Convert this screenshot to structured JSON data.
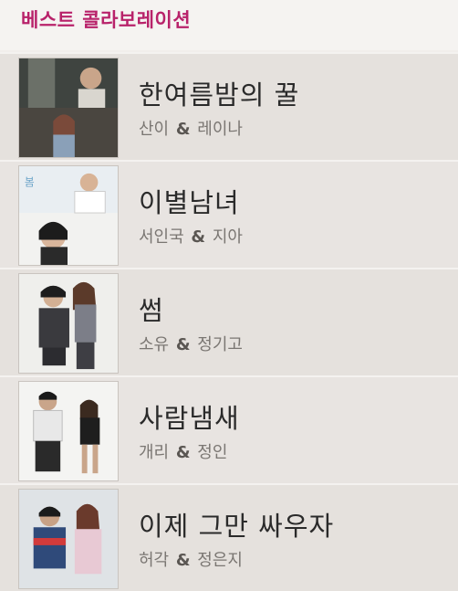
{
  "header": {
    "title": "베스트 콜라보레이션"
  },
  "colors": {
    "title": "#b8226a",
    "song": "#2a2a2a",
    "artist": "#7a7672",
    "row_bg": "#e5e1dd",
    "page_bg": "#f1eeeb"
  },
  "collaborations": [
    {
      "song": "한여름밤의 꿀",
      "artist_a": "산이",
      "separator": "&",
      "artist_b": "레이나",
      "thumbnail_icon": "album-art-photo"
    },
    {
      "song": "이별남녀",
      "artist_a": "서인국",
      "separator": "&",
      "artist_b": "지아",
      "thumbnail_icon": "album-art-photo"
    },
    {
      "song": "썸",
      "artist_a": "소유",
      "separator": "&",
      "artist_b": "정기고",
      "thumbnail_icon": "album-art-photo"
    },
    {
      "song": "사람냄새",
      "artist_a": "개리",
      "separator": "&",
      "artist_b": "정인",
      "thumbnail_icon": "album-art-photo"
    },
    {
      "song": "이제 그만 싸우자",
      "artist_a": "허각",
      "separator": "&",
      "artist_b": "정은지",
      "thumbnail_icon": "album-art-photo"
    }
  ]
}
